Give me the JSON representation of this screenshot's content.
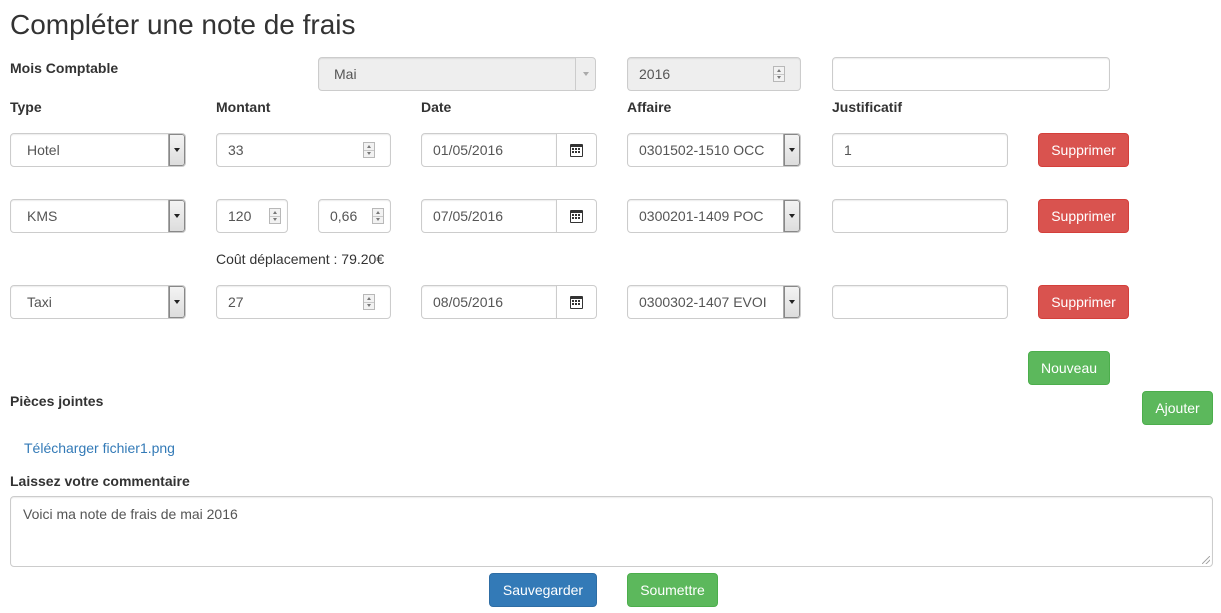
{
  "page": {
    "title": "Compléter une note de frais"
  },
  "period": {
    "label": "Mois Comptable",
    "month": "Mai",
    "year": "2016",
    "extra_value": ""
  },
  "headers": {
    "type": "Type",
    "montant": "Montant",
    "date": "Date",
    "affaire": "Affaire",
    "justificatif": "Justificatif"
  },
  "rows": [
    {
      "type": "Hotel",
      "montant": "33",
      "date": "01/05/2016",
      "affaire": "0301502-1510 OCC",
      "justificatif": "1",
      "delete_label": "Supprimer"
    },
    {
      "type": "KMS",
      "km": "120",
      "rate": "0,66",
      "date": "07/05/2016",
      "affaire": "0300201-1409 POC",
      "justificatif": "",
      "delete_label": "Supprimer",
      "cost_text": "Coût déplacement : 79.20€"
    },
    {
      "type": "Taxi",
      "montant": "27",
      "date": "08/05/2016",
      "affaire": "0300302-1407 EVOI",
      "justificatif": "",
      "delete_label": "Supprimer"
    }
  ],
  "actions": {
    "new_label": "Nouveau",
    "add_label": "Ajouter",
    "save_label": "Sauvegarder",
    "submit_label": "Soumettre"
  },
  "attachments": {
    "label": "Pièces jointes",
    "files": [
      "Télécharger fichier1.png"
    ]
  },
  "comment": {
    "label": "Laissez votre commentaire",
    "value": "Voici ma note de frais de mai 2016"
  },
  "colors": {
    "danger": "#d9534f",
    "success": "#5cb85c",
    "primary": "#337ab7",
    "link": "#337ab7"
  }
}
